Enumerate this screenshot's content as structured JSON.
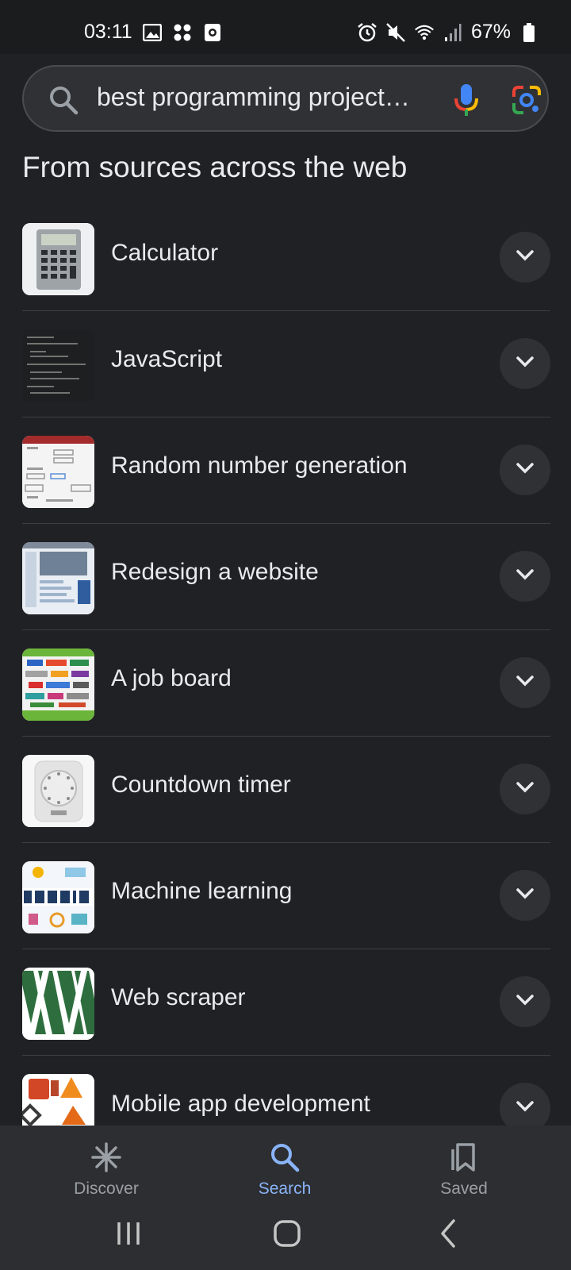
{
  "status_bar": {
    "time": "03:11",
    "battery": "67%",
    "left_icons": [
      "image-icon",
      "app-grid-icon",
      "record-icon"
    ],
    "right_icons": [
      "alarm-icon",
      "mute-icon",
      "wifi-icon",
      "signal-icon",
      "battery-icon"
    ]
  },
  "search": {
    "query": "best programming project…",
    "icons": [
      "search-icon",
      "mic-icon",
      "lens-icon"
    ]
  },
  "section_title": "From sources across the web",
  "results": [
    {
      "label": "Calculator",
      "thumb_icon": "calculator-thumb"
    },
    {
      "label": "JavaScript",
      "thumb_icon": "code-thumb"
    },
    {
      "label": "Random number generation",
      "thumb_icon": "form-thumb"
    },
    {
      "label": "Redesign a website",
      "thumb_icon": "website-thumb"
    },
    {
      "label": "A job board",
      "thumb_icon": "jobboard-thumb"
    },
    {
      "label": "Countdown timer",
      "thumb_icon": "timer-thumb"
    },
    {
      "label": "Machine learning",
      "thumb_icon": "ml-thumb"
    },
    {
      "label": "Web scraper",
      "thumb_icon": "w-logo-thumb"
    },
    {
      "label": "Mobile app development",
      "thumb_icon": "apps-thumb"
    }
  ],
  "bottom_nav": {
    "items": [
      {
        "label": "Discover",
        "icon": "discover-icon",
        "active": false
      },
      {
        "label": "Search",
        "icon": "search-icon",
        "active": true
      },
      {
        "label": "Saved",
        "icon": "bookmark-icon",
        "active": false
      }
    ]
  },
  "colors": {
    "background": "#202124",
    "accent": "#8ab4f8",
    "text": "#e8eaed"
  }
}
